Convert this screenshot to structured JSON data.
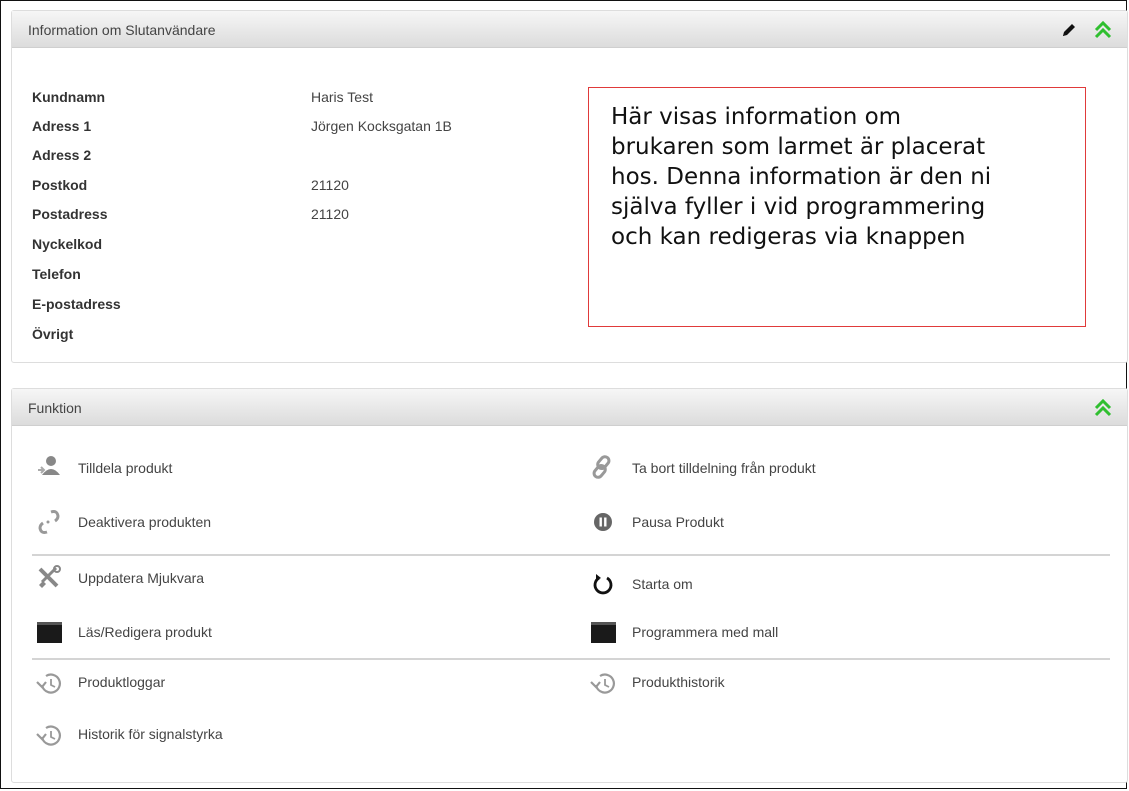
{
  "info_panel": {
    "title": "Information om Slutanvändare",
    "fields": [
      {
        "label": "Kundnamn",
        "value": "Haris Test"
      },
      {
        "label": "Adress 1",
        "value": "Jörgen Kocksgatan 1B"
      },
      {
        "label": "Adress 2",
        "value": ""
      },
      {
        "label": "Postkod",
        "value": "21120"
      },
      {
        "label": "Postadress",
        "value": "21120"
      },
      {
        "label": "Nyckelkod",
        "value": ""
      },
      {
        "label": "Telefon",
        "value": ""
      },
      {
        "label": "E-postadress",
        "value": ""
      },
      {
        "label": "Övrigt",
        "value": ""
      }
    ],
    "note_lines": [
      "Här visas information om",
      "brukaren som larmet är placerat",
      "hos. Denna information är den ni",
      "själva fyller i vid programmering",
      "och kan redigeras via knappen"
    ],
    "icons": [
      "pencil-icon",
      "collapse-chevron-icon"
    ]
  },
  "function_panel": {
    "title": "Funktion",
    "items": [
      {
        "label": "Tilldela produkt",
        "icon": "assign-user-icon"
      },
      {
        "label": "Ta bort tilldelning från produkt",
        "icon": "unlink-icon"
      },
      {
        "label": "Deaktivera produkten",
        "icon": "broken-link-icon"
      },
      {
        "label": "Pausa Produkt",
        "icon": "pause-icon"
      },
      {
        "label": "Uppdatera Mjukvara",
        "icon": "tools-icon"
      },
      {
        "label": "Starta om",
        "icon": "restart-icon"
      },
      {
        "label": "Läs/Redigera produkt",
        "icon": "terminal-icon"
      },
      {
        "label": "Programmera med mall",
        "icon": "terminal-icon"
      },
      {
        "label": "Produktloggar",
        "icon": "history-icon"
      },
      {
        "label": "Produkthistorik",
        "icon": "history-icon"
      },
      {
        "label": "Historik för signalstyrka",
        "icon": "history-icon"
      }
    ]
  },
  "colors": {
    "accent_green": "#2fbf2f",
    "note_border": "#e03a3a"
  }
}
